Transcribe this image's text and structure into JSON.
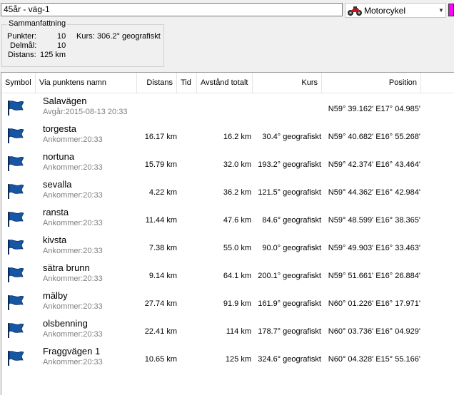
{
  "route": {
    "name": "45år - väg-1",
    "vehicle": "Motorcykel",
    "vehicle_icon": "motorcycle-icon",
    "route_color": "#ff00ff"
  },
  "summary": {
    "title": "Sammanfattning",
    "points_label": "Punkter:",
    "points_value": "10",
    "course_label": "Kurs:",
    "course_value": "306.2° geografiskt",
    "legs_label": "Delmål:",
    "legs_value": "10",
    "distance_label": "Distans:",
    "distance_value": "125 km"
  },
  "columns": {
    "symbol": "Symbol",
    "name": "Via punktens namn",
    "distance": "Distans",
    "time": "Tid",
    "total": "Avstånd totalt",
    "course": "Kurs",
    "position": "Position"
  },
  "waypoints": [
    {
      "name": "Salavägen",
      "sub": "Avgår:2015-08-13 20:33",
      "distance": "",
      "total": "",
      "course": "",
      "position": "N59° 39.162' E17° 04.985'",
      "icon": "flag-icon"
    },
    {
      "name": "torgesta",
      "sub": "Ankommer:20:33",
      "distance": "16.17 km",
      "total": "16.2 km",
      "course": "30.4° geografiskt",
      "position": "N59° 40.682' E16° 55.268'",
      "icon": "flag-icon"
    },
    {
      "name": "nortuna",
      "sub": "Ankommer:20:33",
      "distance": "15.79 km",
      "total": "32.0 km",
      "course": "193.2° geografiskt",
      "position": "N59° 42.374' E16° 43.464'",
      "icon": "flag-icon"
    },
    {
      "name": "sevalla",
      "sub": "Ankommer:20:33",
      "distance": "4.22 km",
      "total": "36.2 km",
      "course": "121.5° geografiskt",
      "position": "N59° 44.362' E16° 42.984'",
      "icon": "flag-icon"
    },
    {
      "name": "ransta",
      "sub": "Ankommer:20:33",
      "distance": "11.44 km",
      "total": "47.6 km",
      "course": "84.6° geografiskt",
      "position": "N59° 48.599' E16° 38.365'",
      "icon": "flag-icon"
    },
    {
      "name": "kivsta",
      "sub": "Ankommer:20:33",
      "distance": "7.38 km",
      "total": "55.0 km",
      "course": "90.0° geografiskt",
      "position": "N59° 49.903' E16° 33.463'",
      "icon": "flag-icon"
    },
    {
      "name": "sätra brunn",
      "sub": "Ankommer:20:33",
      "distance": "9.14 km",
      "total": "64.1 km",
      "course": "200.1° geografiskt",
      "position": "N59° 51.661' E16° 26.884'",
      "icon": "flag-icon"
    },
    {
      "name": "mälby",
      "sub": "Ankommer:20:33",
      "distance": "27.74 km",
      "total": "91.9 km",
      "course": "161.9° geografiskt",
      "position": "N60° 01.226' E16° 17.971'",
      "icon": "flag-icon"
    },
    {
      "name": "olsbenning",
      "sub": "Ankommer:20:33",
      "distance": "22.41 km",
      "total": "114 km",
      "course": "178.7° geografiskt",
      "position": "N60° 03.736' E16° 04.929'",
      "icon": "flag-icon"
    },
    {
      "name": "Fraggvägen 1",
      "sub": "Ankommer:20:33",
      "distance": "10.65 km",
      "total": "125 km",
      "course": "324.6° geografiskt",
      "position": "N60° 04.328' E15° 55.166'",
      "icon": "flag-icon"
    }
  ]
}
